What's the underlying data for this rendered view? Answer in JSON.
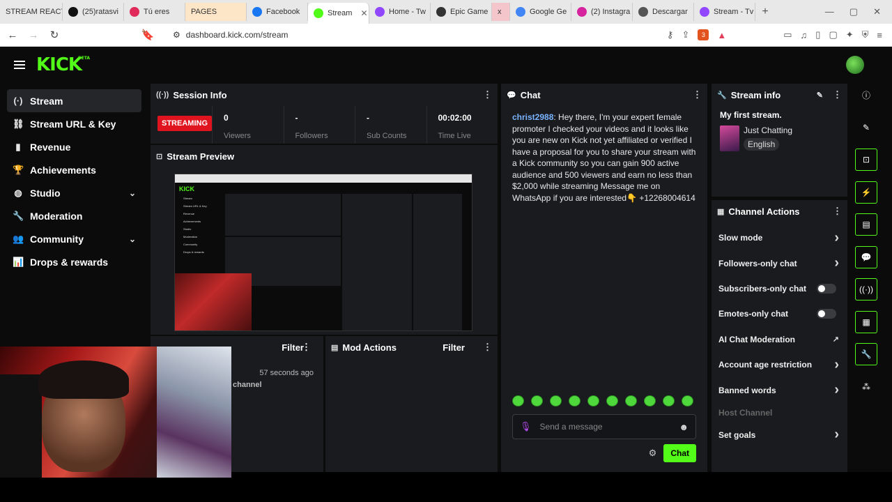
{
  "browser": {
    "tabs": [
      {
        "label": "STREAM REACT",
        "color": "#f3c4c4"
      },
      {
        "label": "(25)ratasvi",
        "color": "#111"
      },
      {
        "label": "Tú eres",
        "color": "#e02a5a"
      },
      {
        "label": "PAGES",
        "color": "#f5c6a0"
      },
      {
        "label": "Facebook",
        "color": "#1877f2"
      },
      {
        "label": "Stream",
        "color": "#53fc18",
        "active": true
      },
      {
        "label": "Home - Tw",
        "color": "#9146ff"
      },
      {
        "label": "Epic Game",
        "color": "#333"
      },
      {
        "label": "x",
        "color": "#e0405a"
      },
      {
        "label": "Google Ge",
        "color": "#4285f4"
      },
      {
        "label": "(2) Instagra",
        "color": "#d6249f"
      },
      {
        "label": "Descargar",
        "color": "#555"
      },
      {
        "label": "Stream - Tv",
        "color": "#9146ff"
      }
    ],
    "url": "dashboard.kick.com/stream",
    "shield_count": "3"
  },
  "app": {
    "logo": "KICK",
    "logo_sup": "BETA",
    "sidebar": [
      {
        "label": "Stream",
        "icon": "(·)",
        "active": true
      },
      {
        "label": "Stream URL & Key",
        "icon": "⛓"
      },
      {
        "label": "Revenue",
        "icon": "▮"
      },
      {
        "label": "Achievements",
        "icon": "🏆"
      },
      {
        "label": "Studio",
        "icon": "◍",
        "chevron": true
      },
      {
        "label": "Moderation",
        "icon": "🔧"
      },
      {
        "label": "Community",
        "icon": "👥",
        "chevron": true
      },
      {
        "label": "Drops & rewards",
        "icon": "📊"
      }
    ],
    "session": {
      "title": "Session Info",
      "status": "STREAMING",
      "stats": [
        {
          "value": "0",
          "label": "Viewers"
        },
        {
          "value": "-",
          "label": "Followers"
        },
        {
          "value": "-",
          "label": "Sub Counts"
        },
        {
          "value": "00:02:00",
          "label": "Time Live"
        }
      ]
    },
    "preview": {
      "title": "Stream Preview"
    },
    "activity": {
      "filter": "Filter",
      "time": "57 seconds ago",
      "text": "channel"
    },
    "mod_actions": {
      "title": "Mod Actions",
      "filter": "Filter"
    },
    "chat": {
      "title": "Chat",
      "username": "christ2988",
      "message": "Hey there, I'm your expert female promoter I checked your videos and it looks like you are new on Kick not yet affiliated or verified I have a proposal for you to share your stream with a Kick community so you can gain 900 active audience and 500 viewers and earn no less than $2,000 while streaming Message me on WhatsApp if you are interested👇 +12268004614",
      "placeholder": "Send a message",
      "button": "Chat"
    },
    "stream_info": {
      "title": "Stream info",
      "stream_title": "My first stream.",
      "category": "Just Chatting",
      "language": "English"
    },
    "channel_actions": {
      "title": "Channel Actions",
      "items": [
        {
          "label": "Slow mode",
          "kind": "chevron"
        },
        {
          "label": "Followers-only chat",
          "kind": "chevron"
        },
        {
          "label": "Subscribers-only chat",
          "kind": "toggle"
        },
        {
          "label": "Emotes-only chat",
          "kind": "toggle"
        },
        {
          "label": "AI Chat Moderation",
          "kind": "external"
        },
        {
          "label": "Account age restriction",
          "kind": "chevron"
        },
        {
          "label": "Banned words",
          "kind": "chevron"
        },
        {
          "label": "Host Channel",
          "kind": "disabled"
        },
        {
          "label": "Set goals",
          "kind": "chevron"
        }
      ]
    }
  }
}
